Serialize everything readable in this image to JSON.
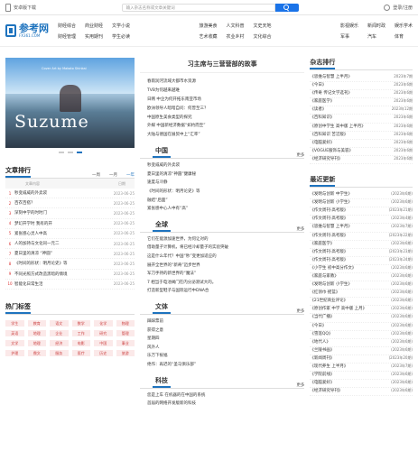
{
  "topbar": {
    "app_label": "安卓版下载",
    "search_placeholder": "输入杂志名称或文章关键词",
    "login_label": "登录/注册"
  },
  "logo": {
    "text": "参考网",
    "sub": "FX361.COM"
  },
  "nav": {
    "group1": [
      "财经综合",
      "商业财经",
      "文学小说",
      "财经管理",
      "实用期刊",
      "学生必读"
    ],
    "group2": [
      "旅游美食",
      "人文科普",
      "文史天地",
      "艺术收藏",
      "农业乡村",
      "文化综合"
    ],
    "group3": [
      "影视娱乐",
      "新闻时政",
      "娱乐学术",
      "军事",
      "汽车",
      "体育"
    ],
    "extra": [
      "学术",
      "环球"
    ]
  },
  "banner": {
    "title": "Suzume",
    "caption": "Cover Art by Makoto Shinkai",
    "slides": 3,
    "active_slide": 2
  },
  "rank": {
    "title": "文章排行",
    "tabs": [
      "一周",
      "一月",
      "一年"
    ],
    "active_tab": 2,
    "col_title": "文章内容",
    "col_date": "日期",
    "items": [
      {
        "title": "秒变威威的外卖袋",
        "date": "2023-06-25"
      },
      {
        "title": "百衣百搭？",
        "date": "2023-06-25"
      },
      {
        "title": "深刻中学的时时门",
        "date": "2023-06-25"
      },
      {
        "title": "梦幻开学时 我有的开",
        "date": "2023-06-25"
      },
      {
        "title": "紧张感心灵人中高",
        "date": "2023-06-25"
      },
      {
        "title": "人的加持与文化同一元二",
        "date": "2023-06-25"
      },
      {
        "title": "夏日里的清凉 “神圆”",
        "date": "2023-06-25"
      },
      {
        "title": "《时间的形状：明月论史》等",
        "date": "2023-06-25"
      },
      {
        "title": "不同光照方式改造黑暗的情境",
        "date": "2023-06-25"
      },
      {
        "title": "智能化日常生活",
        "date": "2023-06-25"
      }
    ]
  },
  "tags": {
    "title": "热门标签",
    "items": [
      "学生",
      "教育",
      "语文",
      "数学",
      "化学",
      "物理",
      "英语",
      "地理",
      "企业",
      "工作",
      "研究",
      "管理",
      "文学",
      "地理",
      "经济",
      "电影",
      "中国",
      "事业",
      "护理",
      "鼎文",
      "服务",
      "医疗",
      "历史",
      "旅游"
    ]
  },
  "headline": "习主席与三营营部的故事",
  "top_news": [
    "春雨润河流域大都市水资源",
    "TVB为何越来越难",
    "日韩 中企为何开拓东南亚市场",
    "欧洲领导人暗暗自问：何曾至三？",
    "中国原生美食类型的探究",
    "外媒 中国新经济数据“如约而至”",
    "大陆与德国在展贸中上“汇率”"
  ],
  "sections": [
    {
      "name": "中国",
      "more": "更多",
      "items": [
        "秒变威威的外卖袋",
        "夏日里的清凉“神圆”健康秘",
        "速度与冷静",
        "《时间的形状：明月论史》等",
        "融结“后面”",
        "紧张感中心人中有“高”"
      ]
    },
    {
      "name": "全球",
      "more": "更多",
      "items": [
        "它们在能源加速世界，为何让对的",
        "借助量子计算机，将已经冷却量子的实验突破",
        "这是什么年代？中国“秒”变更加适应的",
        "展开全世界的“新奇”迈步世界",
        "军刀手持的新世界的“魔法”",
        "7 相当于电池阀门在内分泌测试大的。",
        "打造新型鞋子与国际运行中DNA合"
      ]
    },
    {
      "name": "文体",
      "more": "更多",
      "items": [
        "踩踩票前",
        "获得之意",
        "星期四",
        "风外人",
        "乐万下祝福",
        "绝作：再迟的“圣马俱乐部”"
      ]
    },
    {
      "name": "科技",
      "more": "更多",
      "items": [
        "您是上车 在机器的在中国的系统",
        "首届的网络开发版新的科技"
      ]
    }
  ],
  "magazine_rank": {
    "title": "杂志排行",
    "items": [
      {
        "title": "《思维与智慧 上半月》",
        "date": "2023年7期"
      },
      {
        "title": "《今日》",
        "date": "2023年6期"
      },
      {
        "title": "《传奇 传记文学选刊》",
        "date": "2023年6期"
      },
      {
        "title": "《家庭医学》",
        "date": "2023年6期"
      },
      {
        "title": "《读者》",
        "date": "2023年12期"
      },
      {
        "title": "《百科知识》",
        "date": "2023年6期"
      },
      {
        "title": "《原创中学生 高中版 上半月》",
        "date": "2023年6期"
      },
      {
        "title": "《百科知识 苦涩版》",
        "date": "2023年6期"
      },
      {
        "title": "《电脑爱好》",
        "date": "2023年6期"
      },
      {
        "title": "《VOGUE服饰与美容》",
        "date": "2023年6期"
      },
      {
        "title": "《经济研究导刊》",
        "date": "2023年6期"
      }
    ]
  },
  "latest_update": {
    "title": "最近更新",
    "items": [
      {
        "title": "《发明与创新 中学生》",
        "date": "(2023年6期)"
      },
      {
        "title": "《发明与创新 小学生》",
        "date": "(2023年6期)"
      },
      {
        "title": "《作文周刊·高考版》",
        "date": "(2023年21期)"
      },
      {
        "title": "《作文周刊·高考版》",
        "date": "(2023年4期)"
      },
      {
        "title": "《思维与智慧 上半月》",
        "date": "(2023年7期)"
      },
      {
        "title": "《作文周刊·高考版》",
        "date": "(2023年22期)"
      },
      {
        "title": "《家庭医学》",
        "date": "(2023年6期)"
      },
      {
        "title": "《作文周刊·高考版》",
        "date": "(2023年23期)"
      },
      {
        "title": "《作文周刊·高考版》",
        "date": "(2023年24期)"
      },
      {
        "title": "《小学生 初中高分作文》",
        "date": "(2023年6期)"
      },
      {
        "title": "《家庭与家教》",
        "date": "(2023年6期)"
      },
      {
        "title": "《发明与创新 小学生》",
        "date": "(2023年6期)"
      },
      {
        "title": "《红领巾·摇篮》",
        "date": "(2023年6期)"
      },
      {
        "title": "《21世纪商业评论》",
        "date": "(2023年6期)"
      },
      {
        "title": "《原创作家 中学 高中版 上月》",
        "date": "(2023年6期)"
      },
      {
        "title": "《当代广播》",
        "date": "(2023年6期)"
      },
      {
        "title": "《今日》",
        "date": "(2023年6期)"
      },
      {
        "title": "《雪莲QQ》",
        "date": "(2023年6期)"
      },
      {
        "title": "《地代人》",
        "date": "(2023年6期)"
      },
      {
        "title": "《兰陵书画》",
        "date": "(2023年6期)"
      },
      {
        "title": "《新闻周刊》",
        "date": "(2023年20期)"
      },
      {
        "title": "《现代养生 上半月》",
        "date": "(2023年7期)"
      },
      {
        "title": "《学院前线》",
        "date": "(2023年6期)"
      },
      {
        "title": "《电脑爱好》",
        "date": "(2023年6期)"
      },
      {
        "title": "《经济研究导刊》",
        "date": "(2023年6期)"
      }
    ]
  },
  "colors": {
    "accent": "#1e73be",
    "tag_bg": "#fbe9e9",
    "tag_text": "#c44444"
  }
}
